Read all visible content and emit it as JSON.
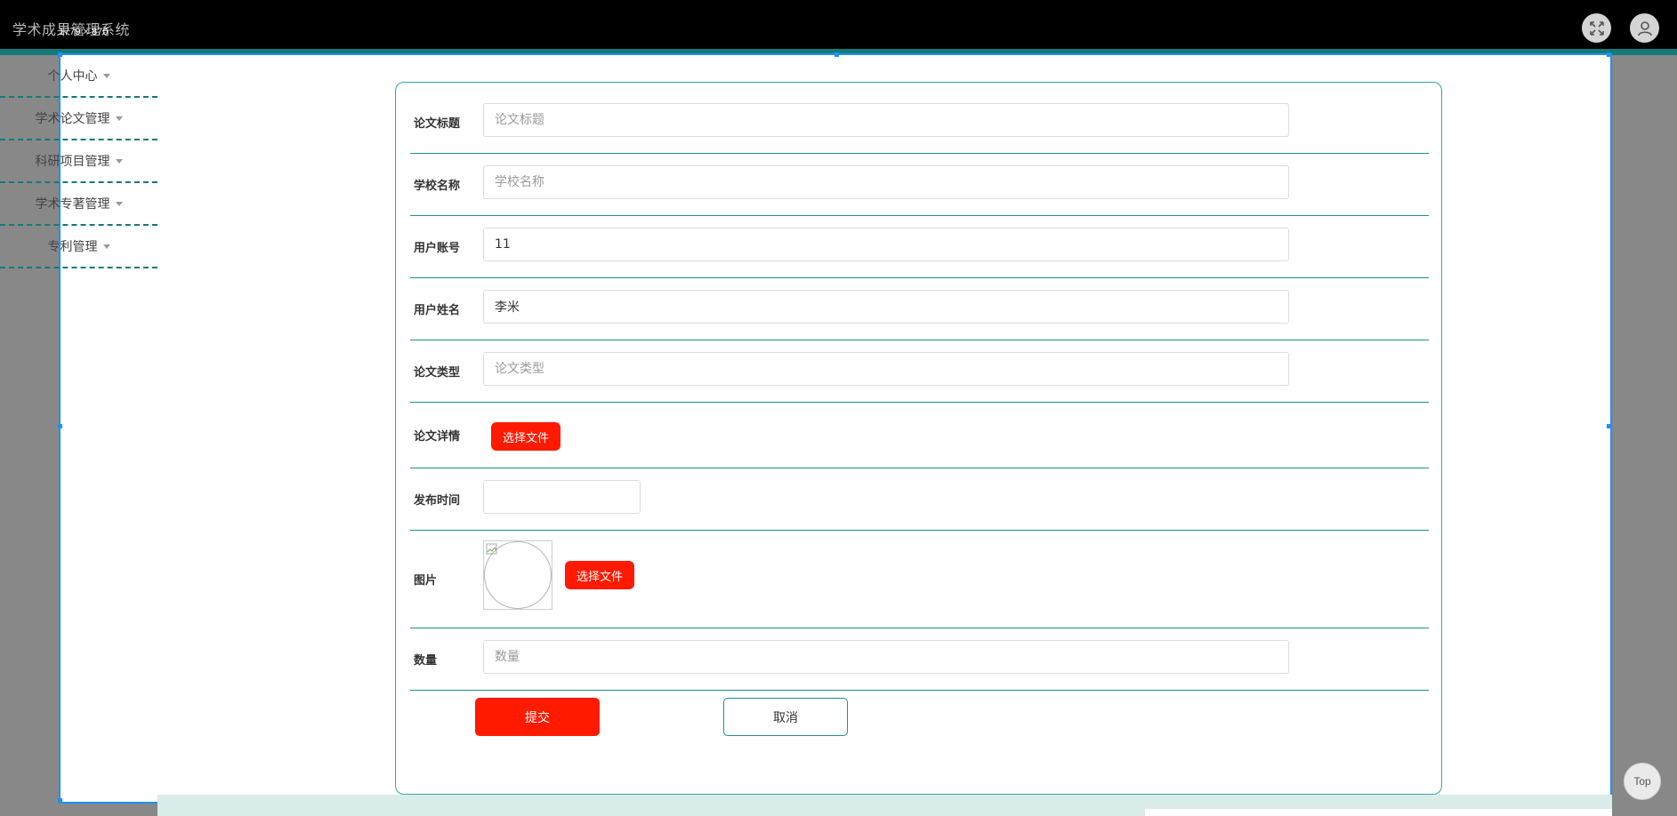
{
  "header": {
    "app_title": "学术成果管理系统",
    "selection_size": "1779 × 870"
  },
  "sidebar": {
    "items": [
      {
        "label": "个人中心"
      },
      {
        "label": "学术论文管理"
      },
      {
        "label": "科研项目管理"
      },
      {
        "label": "学术专著管理"
      },
      {
        "label": "专利管理"
      }
    ]
  },
  "form": {
    "title": {
      "label": "论文标题",
      "value": "",
      "placeholder": "论文标题"
    },
    "school": {
      "label": "学校名称",
      "value": "",
      "placeholder": "学校名称"
    },
    "account": {
      "label": "用户账号",
      "value": "11",
      "placeholder": ""
    },
    "username": {
      "label": "用户姓名",
      "value": "李米",
      "placeholder": ""
    },
    "type": {
      "label": "论文类型",
      "value": "",
      "placeholder": "论文类型"
    },
    "detail": {
      "label": "论文详情",
      "button": "选择文件"
    },
    "publish_time": {
      "label": "发布时间",
      "value": ""
    },
    "image": {
      "label": "图片",
      "button": "选择文件"
    },
    "quantity": {
      "label": "数量",
      "value": "",
      "placeholder": "数量"
    },
    "submit_label": "提交",
    "cancel_label": "取消"
  },
  "back_to_top": "Top",
  "colors": {
    "accent_teal": "#14797a",
    "primary_red": "#ff1a00",
    "selection_blue": "#1e90ff"
  }
}
